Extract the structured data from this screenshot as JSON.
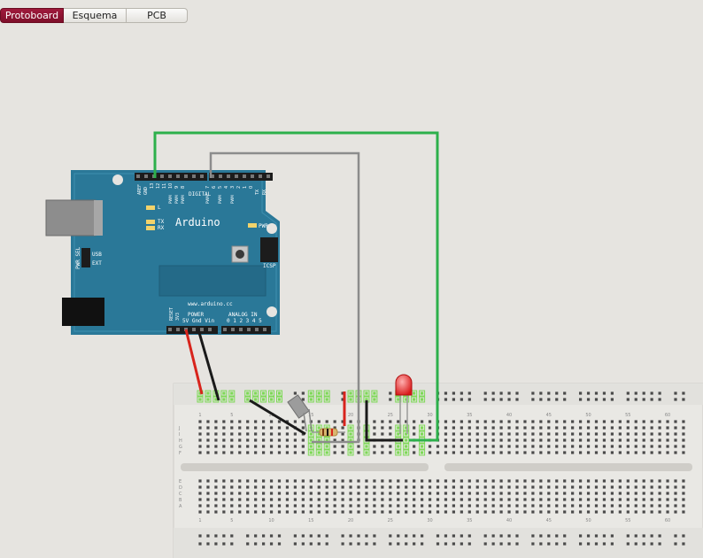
{
  "tabs": [
    {
      "label": "Protoboard",
      "active": true
    },
    {
      "label": "Esquema",
      "active": false
    },
    {
      "label": "PCB",
      "active": false
    }
  ],
  "arduino": {
    "brand": "Arduino",
    "url": "www.arduino.cc",
    "aref": "AREF",
    "gnd_top": "GND",
    "digital": "DIGITAL",
    "digital_pins": [
      "13",
      "12",
      "11",
      "10",
      "9",
      "8",
      "7",
      "6",
      "5",
      "4",
      "3",
      "2",
      "1",
      "0"
    ],
    "pwm": "PWM",
    "tx_rx": [
      "TX",
      "RX"
    ],
    "tx_rx_right": [
      "TX",
      "RX"
    ],
    "led_l": "L",
    "pwr": "PWR",
    "icsp": "ICSP",
    "usb": "USB",
    "ext": "EXT",
    "pwr_sel": "PWR SEL",
    "reset": "RESET",
    "v33": "3V3",
    "power": "POWER",
    "power_pins": "5V Gnd Vin",
    "analog_in": "ANALOG IN",
    "analog_pins": "0 1 2 3 4 5",
    "board_color": "#2a7898"
  },
  "breadboard": {
    "column_numbers": [
      "1",
      "5",
      "10",
      "15",
      "20",
      "25",
      "30",
      "35",
      "40",
      "45",
      "50",
      "55",
      "60"
    ],
    "row_letters_top": [
      "J",
      "I",
      "H",
      "G",
      "F"
    ],
    "row_letters_bottom": [
      "E",
      "D",
      "C",
      "B",
      "A"
    ],
    "hole_highlight_color": "#7ed957"
  },
  "wires": {
    "green": "#2db04b",
    "gray": "#8c8c8c",
    "red": "#d8241c",
    "black": "#1a1a1a"
  },
  "led_color": "#e82424"
}
